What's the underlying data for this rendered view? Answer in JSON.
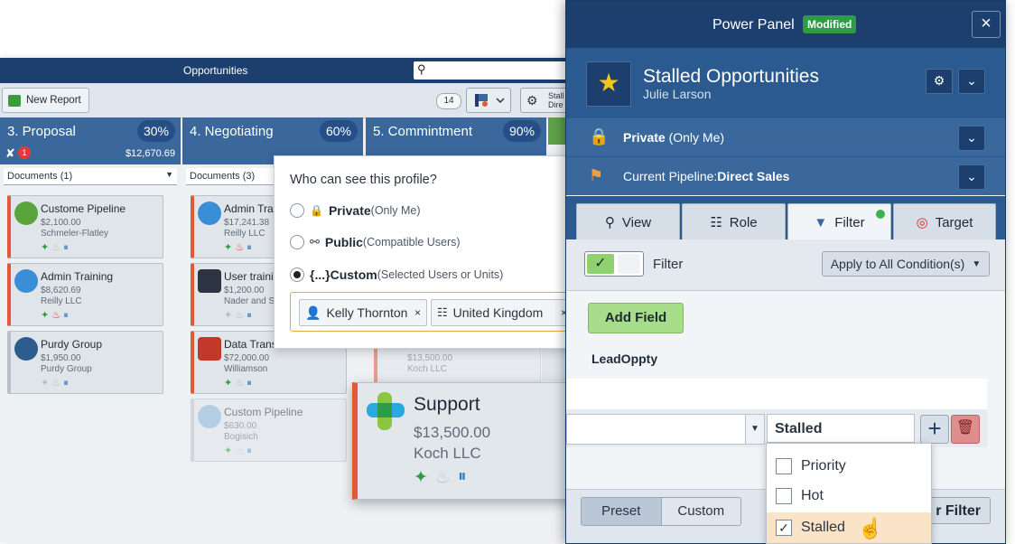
{
  "app": {
    "title": "Opportunities",
    "toolbar": {
      "new_report": "New Report",
      "count": "14",
      "stall_btn": "Stall Dire"
    },
    "stages": [
      {
        "name": "3. Proposal",
        "pct": "30%",
        "total": "$12,670.69",
        "alert_count": "1",
        "docs": "Documents (1)"
      },
      {
        "name": "4. Negotiating",
        "pct": "60%",
        "docs": "Documents (3)"
      },
      {
        "name": "5. Commintment",
        "pct": "90%"
      }
    ],
    "cards": [
      {
        "name": "Custome Pipeline",
        "amount": "$2,100.00",
        "company": "Schmeler-Flatley"
      },
      {
        "name": "Admin Training",
        "amount": "$8,620.69",
        "company": "Reilly LLC"
      },
      {
        "name": "Purdy Group",
        "amount": "$1,950.00",
        "company": "Purdy Group"
      },
      {
        "name": "Admin Tra",
        "amount": "$17,241.38",
        "company": "Reilly LLC"
      },
      {
        "name": "User traini",
        "amount": "$1,200.00",
        "company": "Nader and S"
      },
      {
        "name": "Data Trans",
        "amount": "$72,000.00",
        "company": "Williamson"
      },
      {
        "name": "Custom Pipeline",
        "amount": "$630.00",
        "company": "Bogisich"
      },
      {
        "name": "",
        "amount": "$13,500.00",
        "company": "Koch LLC"
      }
    ]
  },
  "visibility_popup": {
    "question": "Who can see this profile?",
    "options": [
      {
        "label": "Private",
        "sub": "(Only Me)"
      },
      {
        "label": "Public",
        "sub": "(Compatible Users)"
      },
      {
        "prefix": "{...}",
        "label": "Custom",
        "sub": "(Selected Users or Units)"
      }
    ],
    "chips": [
      "Kelly Thornton",
      "United Kingdom"
    ],
    "chip_remove": "×"
  },
  "support_card": {
    "name": "Support",
    "amount": "$13,500.00",
    "company": "Koch LLC"
  },
  "panel": {
    "title": "Power Panel",
    "badge": "Modified",
    "close": "×",
    "profile_name": "Stalled Opportunities",
    "profile_user": "Julie Larson",
    "privacy_label": "Private",
    "privacy_sub": "(Only Me)",
    "pipeline_prefix": "Current Pipeline:",
    "pipeline_name": "Direct Sales",
    "tabs": [
      "View",
      "Role",
      "Filter",
      "Target"
    ],
    "filter_label": "Filter",
    "apply_mode": "Apply to All Condition(s)",
    "add_field": "Add Field",
    "field_name": "LeadOppty",
    "condition_value": "Stalled",
    "options": [
      {
        "label": "Priority",
        "checked": false
      },
      {
        "label": "Hot",
        "checked": false
      },
      {
        "label": "Stalled",
        "checked": true
      }
    ],
    "segments": [
      "Preset",
      "Custom"
    ],
    "apply_filter": "r Filter"
  },
  "colors": {
    "navy": "#1d3f6e",
    "accent_orange": "#e05a3a",
    "modified_green": "#2e9c47",
    "add_field_green": "#a6dc8a"
  }
}
